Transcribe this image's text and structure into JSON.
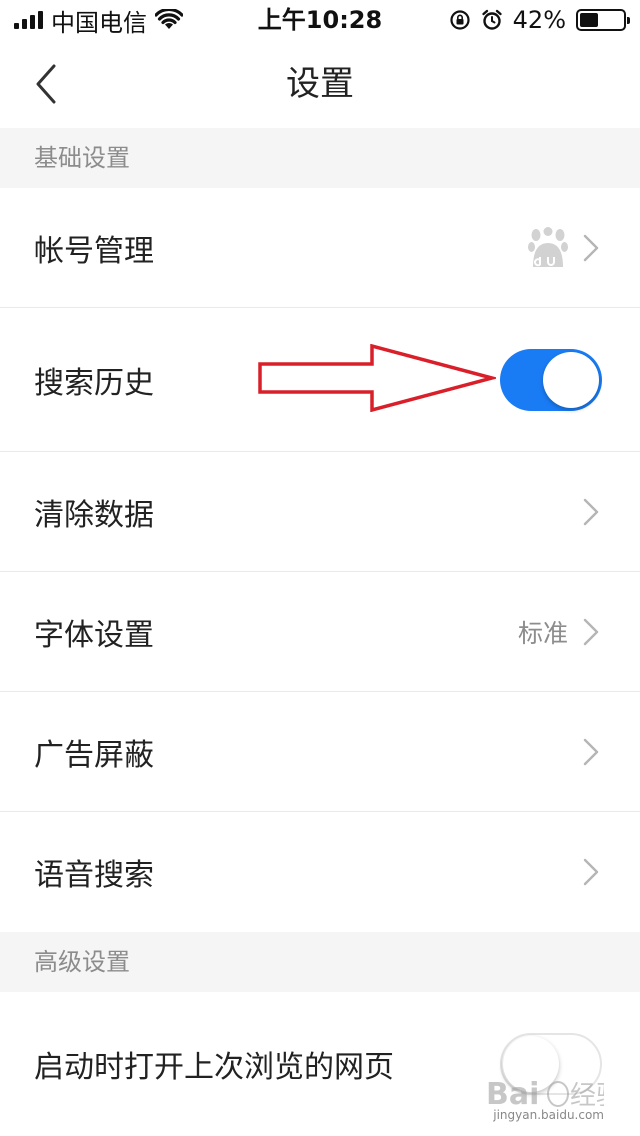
{
  "status_bar": {
    "carrier": "中国电信",
    "time": "上午10:28",
    "battery_percent": "42%",
    "battery_level": 0.42
  },
  "nav": {
    "title": "设置"
  },
  "sections": {
    "basic": "基础设置",
    "advanced": "高级设置"
  },
  "rows": {
    "account": "帐号管理",
    "search_history": "搜索历史",
    "clear_data": "清除数据",
    "font": "字体设置",
    "font_value": "标准",
    "ad_block": "广告屏蔽",
    "voice_search": "语音搜索",
    "restore_last": "启动时打开上次浏览的网页"
  },
  "toggles": {
    "search_history_on": true,
    "restore_last_on": false
  },
  "watermark": {
    "text": "jingyan.baidu.com"
  },
  "colors": {
    "toggle_on": "#1a7cf5",
    "annotation_arrow": "#d9202a",
    "section_bg": "#f5f5f5"
  },
  "icons": {
    "account_row": "baidu-paw-icon",
    "row_chevron": "chevron-right-icon",
    "back": "chevron-left-icon"
  }
}
